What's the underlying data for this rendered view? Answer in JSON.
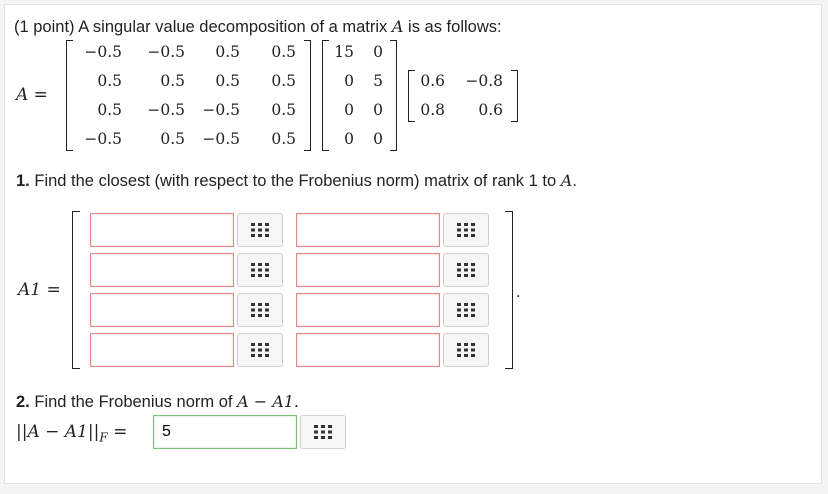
{
  "header": {
    "points": "(1 point)",
    "intro": "A singular value decomposition of a matrix",
    "matrix_name": "A",
    "intro_end": "is as follows:"
  },
  "svd": {
    "lhs": "A =",
    "U": [
      [
        "−0.5",
        "−0.5",
        "0.5",
        "0.5"
      ],
      [
        "0.5",
        "0.5",
        "0.5",
        "0.5"
      ],
      [
        "0.5",
        "−0.5",
        "−0.5",
        "0.5"
      ],
      [
        "−0.5",
        "0.5",
        "−0.5",
        "0.5"
      ]
    ],
    "Sigma": [
      [
        "15",
        "0"
      ],
      [
        "0",
        "5"
      ],
      [
        "0",
        "0"
      ],
      [
        "0",
        "0"
      ]
    ],
    "VT": [
      [
        "0.6",
        "−0.8"
      ],
      [
        "0.8",
        "0.6"
      ]
    ]
  },
  "q1": {
    "number": "1.",
    "text": "Find the closest (with respect to the Frobenius norm) matrix of rank 1 to",
    "var": "A",
    "end": ".",
    "lhs": "A1 =",
    "period": ".",
    "inputs": [
      [
        "",
        ""
      ],
      [
        "",
        ""
      ],
      [
        "",
        ""
      ],
      [
        "",
        ""
      ]
    ]
  },
  "q2": {
    "number": "2.",
    "text": "Find the Frobenius norm of",
    "expr": "A − A1.",
    "lhs": "||A − A1||",
    "sub": "F",
    "eq": "=",
    "value": "5"
  }
}
